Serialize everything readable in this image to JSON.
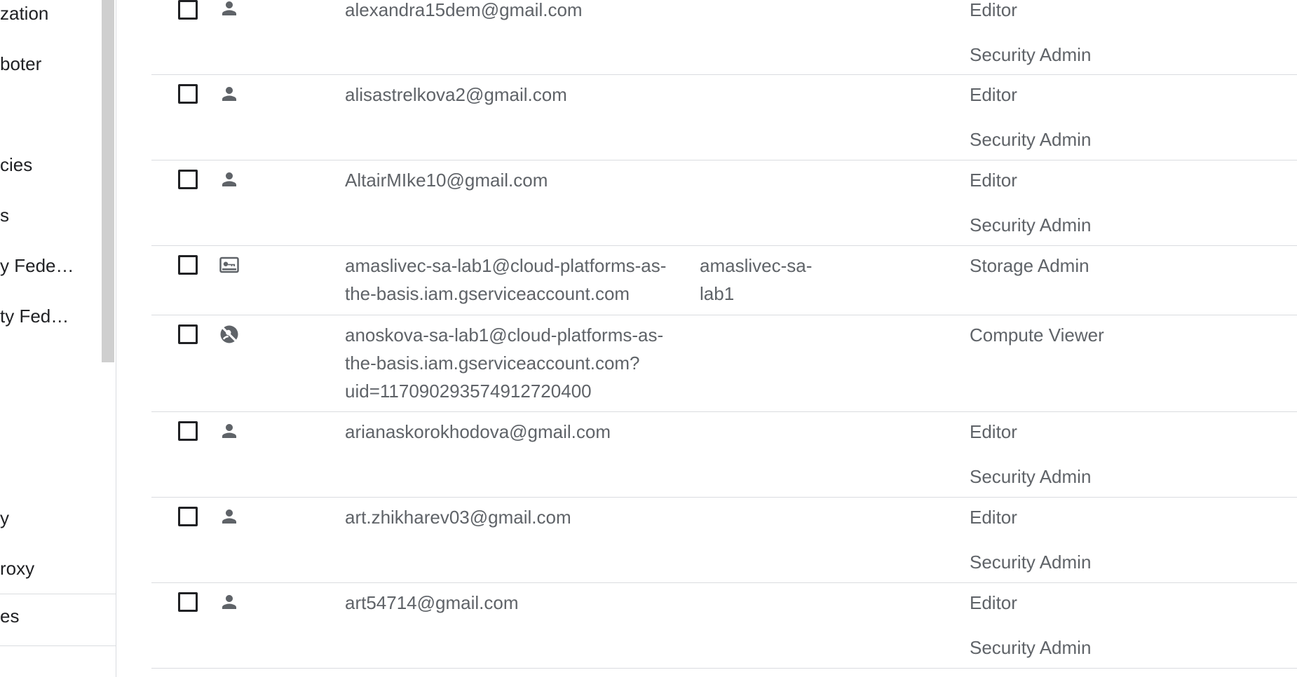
{
  "sidebar": {
    "items": [
      {
        "label": "zation"
      },
      {
        "label": "boter"
      },
      {
        "label": "cies"
      },
      {
        "label": "s"
      },
      {
        "label": "y Fede…"
      },
      {
        "label": "ty Fed…"
      },
      {
        "label": "y"
      },
      {
        "label": "roxy"
      },
      {
        "label": "es"
      }
    ]
  },
  "table": {
    "rows": [
      {
        "member": "alexandra15dem@gmail.com",
        "name": "",
        "roles": [
          "Editor",
          "Security Admin"
        ],
        "type": "person-icon"
      },
      {
        "member": "alisastrelkova2@gmail.com",
        "name": "",
        "roles": [
          "Editor",
          "Security Admin"
        ],
        "type": "person-icon"
      },
      {
        "member": "AltairMIke10@gmail.com",
        "name": "",
        "roles": [
          "Editor",
          "Security Admin"
        ],
        "type": "person-icon"
      },
      {
        "member": "amaslivec-sa-lab1@cloud-platforms-as-the-basis.iam.gserviceaccount.com",
        "member_lines": [
          "amaslivec-sa-lab1@cloud-platforms-as-",
          "the-basis.iam.gserviceaccount.com"
        ],
        "name_lines": [
          "amaslivec-sa-",
          "lab1"
        ],
        "roles": [
          "Storage Admin"
        ],
        "type": "service-account-icon"
      },
      {
        "member": "anoskova-sa-lab1@cloud-platforms-as-the-basis.iam.gserviceaccount.com?uid=117090293574912720400",
        "member_lines": [
          "anoskova-sa-lab1@cloud-platforms-as-",
          "the-basis.iam.gserviceaccount.com?",
          "uid=117090293574912720400"
        ],
        "name": "",
        "roles": [
          "Compute Viewer"
        ],
        "type": "deleted-account-icon"
      },
      {
        "member": "arianaskorokhodova@gmail.com",
        "name": "",
        "roles": [
          "Editor",
          "Security Admin"
        ],
        "type": "person-icon"
      },
      {
        "member": "art.zhikharev03@gmail.com",
        "name": "",
        "roles": [
          "Editor",
          "Security Admin"
        ],
        "type": "person-icon"
      },
      {
        "member": "art54714@gmail.com",
        "name": "",
        "roles": [
          "Editor",
          "Security Admin"
        ],
        "type": "person-icon"
      }
    ]
  }
}
